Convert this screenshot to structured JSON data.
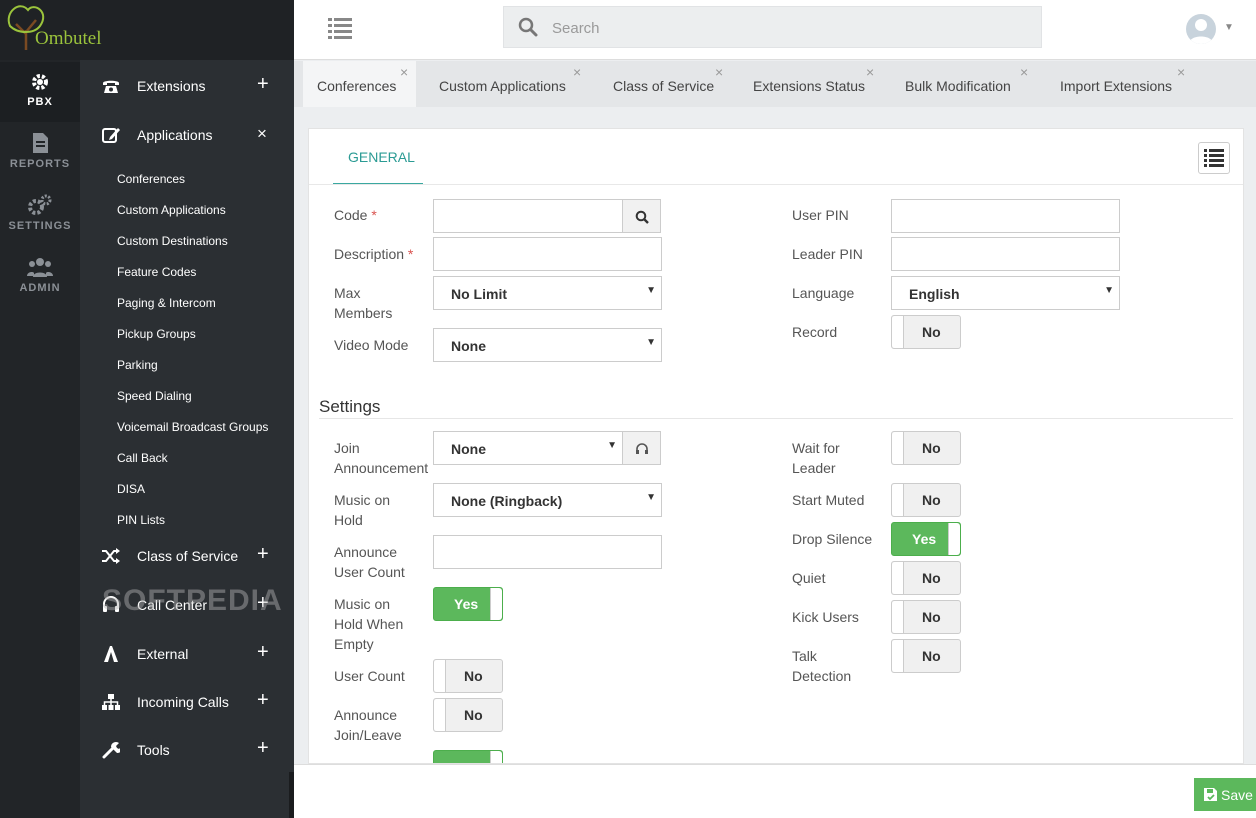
{
  "app": {
    "name": "Ombutel"
  },
  "rail": [
    {
      "label": "PBX",
      "icon": "gear-icon",
      "active": true
    },
    {
      "label": "REPORTS",
      "icon": "document-icon"
    },
    {
      "label": "SETTINGS",
      "icon": "gears-icon"
    },
    {
      "label": "ADMIN",
      "icon": "users-icon"
    }
  ],
  "sidebar": {
    "groups": [
      {
        "label": "Extensions",
        "icon": "phone-icon",
        "toggle": "+"
      },
      {
        "label": "Applications",
        "icon": "edit-icon",
        "toggle": "×"
      },
      {
        "label": "Class of Service",
        "icon": "shuffle-icon",
        "toggle": "+"
      },
      {
        "label": "Call Center",
        "icon": "headset-icon",
        "toggle": "+"
      },
      {
        "label": "External",
        "icon": "external-icon",
        "toggle": "+"
      },
      {
        "label": "Incoming Calls",
        "icon": "sitemap-icon",
        "toggle": "+"
      },
      {
        "label": "Tools",
        "icon": "wrench-icon",
        "toggle": "+"
      }
    ],
    "applications": [
      "Conferences",
      "Custom Applications",
      "Custom Destinations",
      "Feature Codes",
      "Paging & Intercom",
      "Pickup Groups",
      "Parking",
      "Speed Dialing",
      "Voicemail Broadcast Groups",
      "Call Back",
      "DISA",
      "PIN Lists"
    ],
    "watermark": "SOFTPEDIA"
  },
  "search": {
    "placeholder": "Search"
  },
  "tabs": [
    {
      "label": "Conferences",
      "close": "×",
      "active": true
    },
    {
      "label": "Custom Applications",
      "close": "×"
    },
    {
      "label": "Class of Service",
      "close": "×"
    },
    {
      "label": "Extensions Status",
      "close": "×"
    },
    {
      "label": "Bulk Modification",
      "close": "×"
    },
    {
      "label": "Import Extensions",
      "close": "×"
    }
  ],
  "form": {
    "subtab": "GENERAL",
    "code": {
      "label": "Code",
      "required": "*",
      "value": ""
    },
    "description": {
      "label": "Description",
      "required": "*",
      "value": ""
    },
    "max_members": {
      "label": "Max\nMembers",
      "value": "No Limit"
    },
    "video_mode": {
      "label": "Video Mode",
      "value": "None"
    },
    "user_pin": {
      "label": "User PIN",
      "value": ""
    },
    "leader_pin": {
      "label": "Leader PIN",
      "value": ""
    },
    "language": {
      "label": "Language",
      "value": "English"
    },
    "record": {
      "label": "Record",
      "value": "No"
    },
    "settings_heading": "Settings",
    "join_announcement": {
      "label": "Join\nAnnouncement",
      "value": "None"
    },
    "music_on_hold": {
      "label": "Music on\nHold",
      "value": "None (Ringback)"
    },
    "announce_user_count": {
      "label": "Announce\nUser Count",
      "value": ""
    },
    "moh_when_empty": {
      "label": "Music on\nHold When\nEmpty",
      "value": "Yes"
    },
    "user_count": {
      "label": "User Count",
      "value": "No"
    },
    "announce_join_leave": {
      "label": "Announce\nJoin/Leave",
      "value": "No"
    },
    "wait_for_leader": {
      "label": "Wait for\nLeader",
      "value": "No"
    },
    "start_muted": {
      "label": "Start Muted",
      "value": "No"
    },
    "drop_silence": {
      "label": "Drop Silence",
      "value": "Yes"
    },
    "quiet": {
      "label": "Quiet",
      "value": "No"
    },
    "kick_users": {
      "label": "Kick Users",
      "value": "No"
    },
    "talk_detection": {
      "label": "Talk\nDetection",
      "value": "No"
    }
  },
  "footer": {
    "save_label": "Save"
  },
  "colors": {
    "accent": "#2b9b94",
    "success": "#5cb85c",
    "sidebar": "#2b2f33",
    "rail": "#222528"
  }
}
